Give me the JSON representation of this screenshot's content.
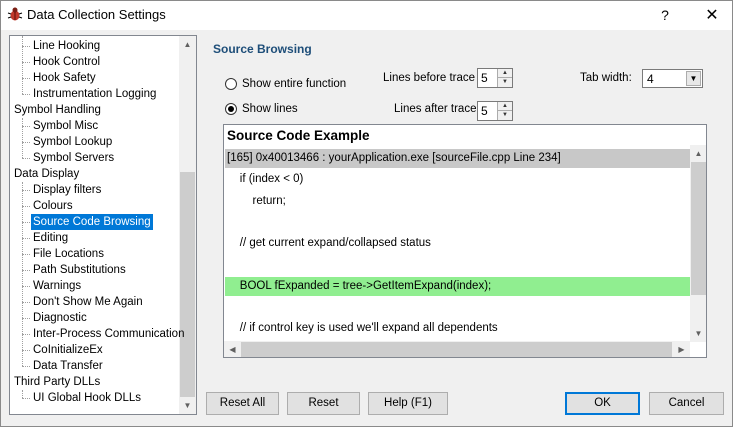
{
  "window": {
    "title": "Data Collection Settings",
    "help_label": "?",
    "close_label": "✕"
  },
  "tree": {
    "items": [
      {
        "label": "Line Hooking",
        "level": 1
      },
      {
        "label": "Hook Control",
        "level": 1
      },
      {
        "label": "Hook Safety",
        "level": 1
      },
      {
        "label": "Instrumentation Logging",
        "level": 1
      },
      {
        "label": "Symbol Handling",
        "level": 0
      },
      {
        "label": "Symbol Misc",
        "level": 1
      },
      {
        "label": "Symbol Lookup",
        "level": 1
      },
      {
        "label": "Symbol Servers",
        "level": 1
      },
      {
        "label": "Data Display",
        "level": 0
      },
      {
        "label": "Display filters",
        "level": 1
      },
      {
        "label": "Colours",
        "level": 1
      },
      {
        "label": "Source Code Browsing",
        "level": 1,
        "selected": true
      },
      {
        "label": "Editing",
        "level": 1
      },
      {
        "label": "File Locations",
        "level": 1
      },
      {
        "label": "Path Substitutions",
        "level": 1
      },
      {
        "label": "Warnings",
        "level": 1
      },
      {
        "label": "Don't Show Me Again",
        "level": 1
      },
      {
        "label": "Diagnostic",
        "level": 1
      },
      {
        "label": "Inter-Process Communication",
        "level": 1
      },
      {
        "label": "CoInitializeEx",
        "level": 1
      },
      {
        "label": "Data Transfer",
        "level": 1
      },
      {
        "label": "Third Party DLLs",
        "level": 0
      },
      {
        "label": "UI Global Hook DLLs",
        "level": 1
      }
    ]
  },
  "source_browsing": {
    "title": "Source Browsing",
    "show_entire_function_label": "Show entire function",
    "show_lines_label": "Show lines",
    "selected_mode": "show_lines",
    "lines_before_label": "Lines before trace",
    "lines_before_value": "5",
    "lines_after_label": "Lines after trace",
    "lines_after_value": "5",
    "tab_width_label": "Tab width:",
    "tab_width_value": "4"
  },
  "code_example": {
    "title": "Source Code Example",
    "lines": [
      {
        "text": "[165] 0x40013466 : yourApplication.exe [sourceFile.cpp Line 234]",
        "style": "header"
      },
      {
        "text": "    if (index < 0)",
        "style": "normal"
      },
      {
        "text": "        return;",
        "style": "normal"
      },
      {
        "text": "",
        "style": "normal"
      },
      {
        "text": "    // get current expand/collapsed status",
        "style": "normal"
      },
      {
        "text": "",
        "style": "normal"
      },
      {
        "text": "    BOOL fExpanded = tree->GetItemExpand(index);",
        "style": "highlight"
      },
      {
        "text": "",
        "style": "normal"
      },
      {
        "text": "    // if control key is used we'll expand all dependents",
        "style": "normal"
      }
    ]
  },
  "buttons": {
    "reset_all": "Reset All",
    "reset": "Reset",
    "help": "Help (F1)",
    "ok": "OK",
    "cancel": "Cancel"
  },
  "colors": {
    "selection": "#0078d7",
    "section_title": "#1e4e79",
    "code_header_bg": "#c8c8c8",
    "code_highlight_bg": "#90ee90"
  }
}
